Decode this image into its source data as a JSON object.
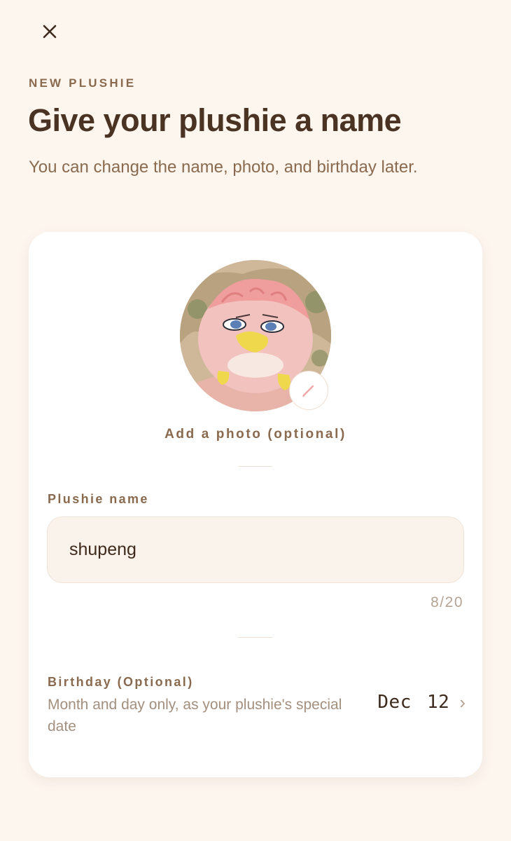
{
  "header": {
    "eyebrow": "NEW PLUSHIE",
    "title": "Give your plushie a name",
    "subtitle": "You can change the name, photo, and birthday later."
  },
  "photo": {
    "add_label": "Add a photo (optional)",
    "edit_icon": "pencil-icon"
  },
  "name_field": {
    "label": "Plushie name",
    "value": "shupeng",
    "counter": "8/20"
  },
  "birthday": {
    "label": "Birthday (Optional)",
    "description": "Month and day only, as your plushie's special date",
    "value": "Dec 12",
    "chevron": "›"
  },
  "colors": {
    "background": "#fdf6ef",
    "card": "#ffffff",
    "title": "#4a3322",
    "muted": "#8a6a4e",
    "accent_pink": "#f2a7a7"
  }
}
